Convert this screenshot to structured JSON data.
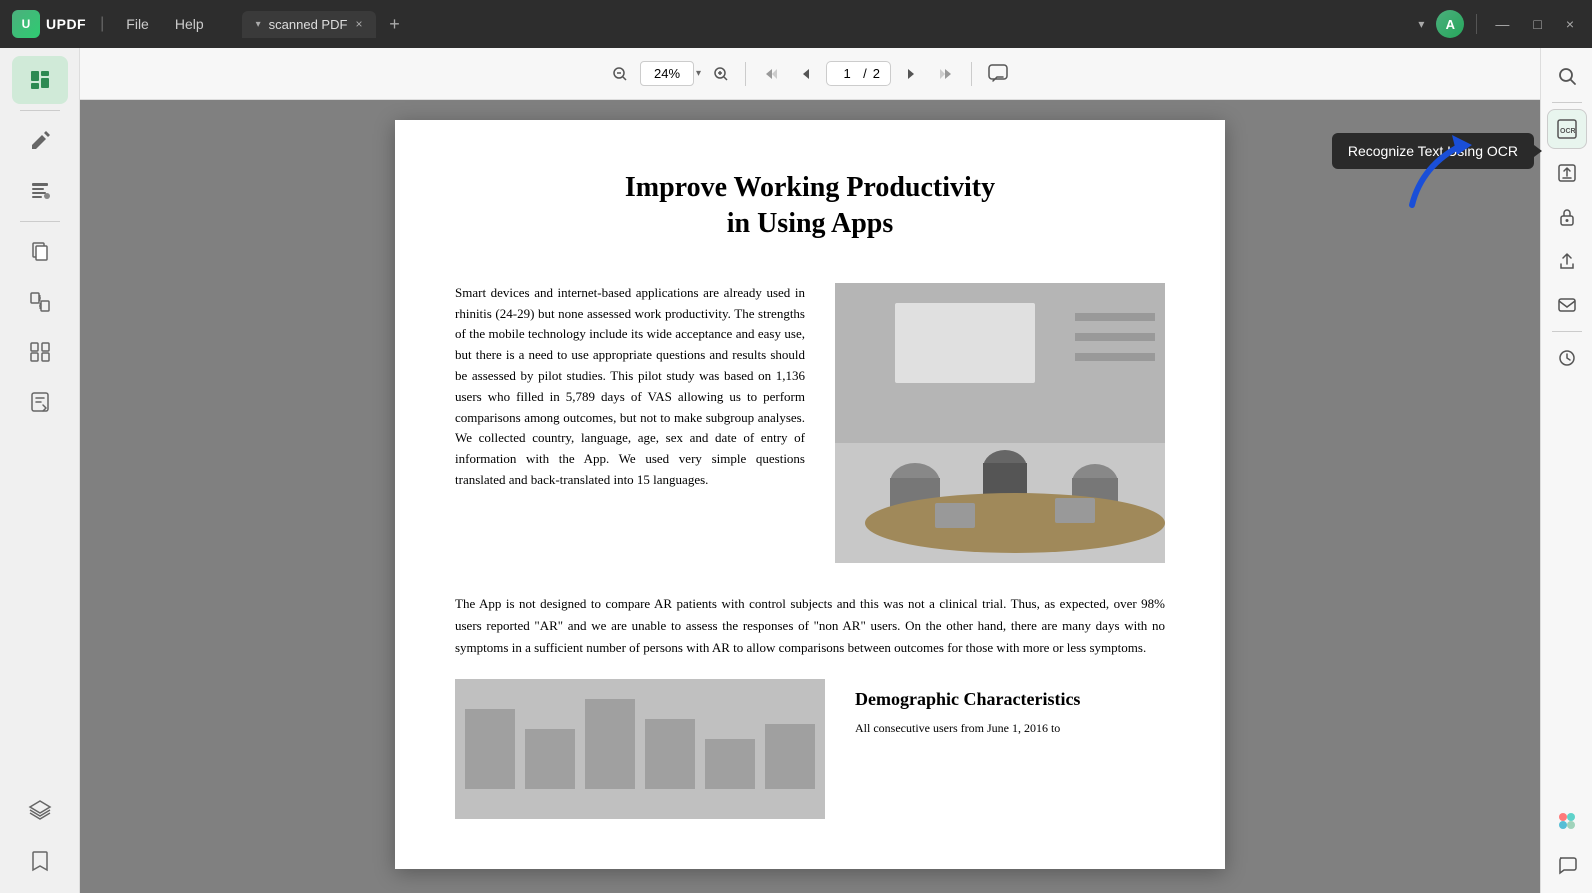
{
  "app": {
    "name": "UPDF",
    "logo_letter": "U"
  },
  "titlebar": {
    "menu_file": "File",
    "menu_help": "Help",
    "tab_name": "scanned PDF",
    "tab_close": "×",
    "tab_add": "+",
    "user_initial": "A",
    "win_minimize": "—",
    "win_maximize": "□",
    "win_close": "×"
  },
  "toolbar": {
    "zoom_out": "−",
    "zoom_in": "+",
    "zoom_value": "24%",
    "zoom_dropdown": "▾",
    "nav_first": "⟨⟨",
    "nav_prev": "⟨",
    "nav_next": "⟩",
    "nav_last": "⟩⟩",
    "page_current": "1",
    "page_sep": "/",
    "page_total": "2",
    "comment": "💬"
  },
  "sidebar_left": {
    "items": [
      {
        "icon": "📄",
        "name": "view-mode",
        "active": true
      },
      {
        "icon": "✏️",
        "name": "edit-mode"
      },
      {
        "icon": "📝",
        "name": "annotate-mode"
      },
      {
        "icon": "📑",
        "name": "pages-mode"
      },
      {
        "icon": "🔄",
        "name": "convert-mode"
      },
      {
        "icon": "📋",
        "name": "organize-mode"
      },
      {
        "icon": "📦",
        "name": "extract-mode"
      }
    ],
    "bottom_items": [
      {
        "icon": "⬡",
        "name": "integrations"
      },
      {
        "icon": "🔖",
        "name": "bookmarks"
      }
    ]
  },
  "pdf": {
    "title_line1": "Improve Working Productivity",
    "title_line2": "in Using Apps",
    "paragraph1": "Smart devices and internet-based applications are already used in rhinitis (24-29) but none assessed work productivity. The strengths of the mobile technology include its wide acceptance and easy use, but there is a need to use appropriate questions and results should be assessed by pilot studies. This pilot study was based on 1,136 users who filled in 5,789 days of VAS allowing us to perform comparisons among outcomes, but not to make subgroup analyses. We collected country, language, age, sex and date of entry of information with the App. We used very simple questions translated and back-translated into 15 languages.",
    "paragraph2": "The App is not designed to compare AR patients with control subjects and this was not a clinical trial. Thus, as expected, over 98% users reported \"AR\" and we are unable to assess the responses of \"non AR\" users. On the other hand, there are many days with no symptoms in a sufficient number of persons with AR to allow comparisons between outcomes for those with more or less symptoms.",
    "section_title": "Demographic Characteristics",
    "paragraph3": "All consecutive users from June 1, 2016 to"
  },
  "ocr_tooltip": {
    "label": "Recognize Text Using OCR"
  },
  "right_sidebar": {
    "search_icon": "🔍",
    "ocr_icon": "OCR",
    "export_icon": "↑",
    "lock_icon": "🔒",
    "share_icon": "⬆",
    "email_icon": "✉",
    "history_icon": "🕐",
    "colorful_icon": "✦",
    "chat_icon": "💬"
  }
}
